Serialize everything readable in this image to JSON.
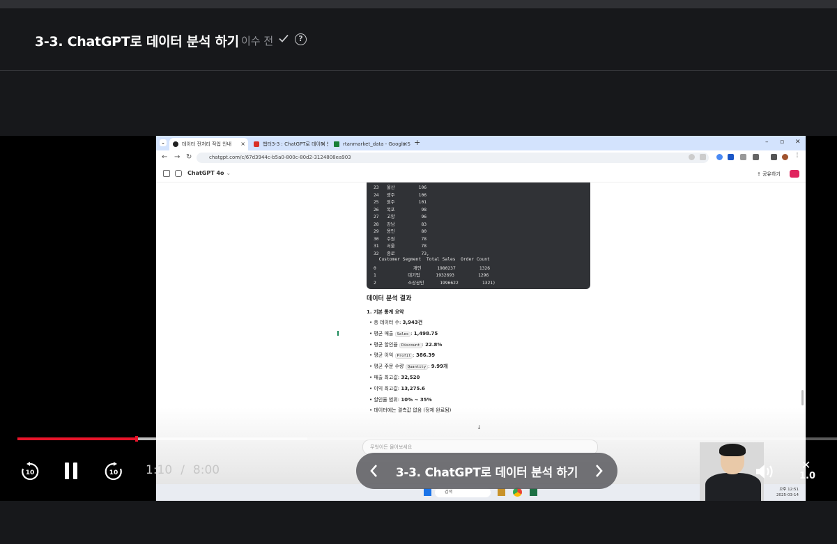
{
  "header": {
    "lesson_title": "3-3. ChatGPT로 데이터 분석 하기",
    "completion_label": "이수 전"
  },
  "video": {
    "browser": {
      "tabs": [
        {
          "label": "데이터 전처리 작업 안내",
          "color": "#222222"
        },
        {
          "label": "챕터3-3 : ChatGPT로 데이터 분",
          "color": "#d93025"
        },
        {
          "label": "rtanmarket_data - Google She",
          "color": "#188038"
        }
      ],
      "url": "chatgpt.com/c/67d3944c-b5a0-800c-80d2-3124808ea903"
    },
    "chatgpt": {
      "model_label": "ChatGPT 4o",
      "share_label": "공유하기",
      "code_rows": [
        "23   울산         106",
        "24   광주         106",
        "25   원주         101",
        "26   목포          98",
        "27   고양          96",
        "28   강남          83",
        "29   용인          80",
        "30   수원          78",
        "31   서울          78",
        "32   종로          73,",
        "  Customer Segment  Total Sales  Order Count",
        "0              개인      1980237         1326",
        "1            대기업      1932693         1296",
        "2            소상공인      1996622         1321)"
      ],
      "section_title": "데이터 분석 결과",
      "subsection_title": "1. 기본 통계 요약",
      "stats": [
        {
          "label": "총 데이터 수: ",
          "tag": "",
          "value": "3,943건"
        },
        {
          "label": "평균 매출 ",
          "tag": "Sales",
          "value": "1,498.75"
        },
        {
          "label": "평균 할인율 ",
          "tag": "Discount",
          "value": "22.8%"
        },
        {
          "label": "평균 이익 ",
          "tag": "Profit",
          "value": "386.39"
        },
        {
          "label": "평균 주문 수량 ",
          "tag": "Quantity",
          "value": "9.99개"
        },
        {
          "label": "매출 최고값: ",
          "tag": "",
          "value": "32,520"
        },
        {
          "label": "이익 최고값: ",
          "tag": "",
          "value": "13,275.6"
        },
        {
          "label": "할인율 범위: ",
          "tag": "",
          "value": "10% ~ 35%"
        },
        {
          "label": "데이터에는 결측값 없음 (정제 완료됨)",
          "tag": "",
          "value": ""
        }
      ],
      "input_placeholder": "무엇이든 물어보세요"
    },
    "taskbar": {
      "search_label": "검색",
      "clock_time": "오후 12:51",
      "clock_date": "2025-03-14"
    }
  },
  "player": {
    "current_time": "1:10",
    "time_separator": "/",
    "duration": "8:00",
    "progress_played_fraction": 0.1458,
    "progress_buffered_fraction": 0.354,
    "skip_back_seconds": "10",
    "skip_forward_seconds": "10",
    "playlist_title": "3-3. ChatGPT로 데이터 분석 하기",
    "playback_speed": "1.0",
    "colors": {
      "accent": "#e8142a"
    }
  }
}
